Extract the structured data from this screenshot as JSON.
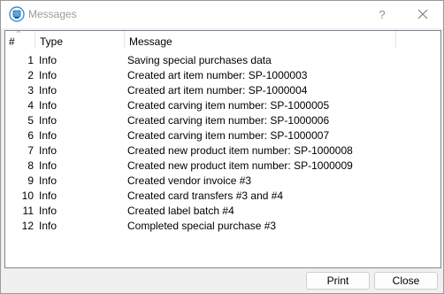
{
  "window": {
    "title": "Messages",
    "help_label": "?"
  },
  "table": {
    "columns": {
      "number": "#",
      "type": "Type",
      "message": "Message"
    },
    "rows": [
      {
        "num": "1",
        "type": "Info",
        "message": "Saving special purchases data"
      },
      {
        "num": "2",
        "type": "Info",
        "message": "Created art item number: SP-1000003"
      },
      {
        "num": "3",
        "type": "Info",
        "message": "Created art item number: SP-1000004"
      },
      {
        "num": "4",
        "type": "Info",
        "message": "Created carving item number: SP-1000005"
      },
      {
        "num": "5",
        "type": "Info",
        "message": "Created carving item number: SP-1000006"
      },
      {
        "num": "6",
        "type": "Info",
        "message": "Created carving item number: SP-1000007"
      },
      {
        "num": "7",
        "type": "Info",
        "message": "Created new product item number: SP-1000008"
      },
      {
        "num": "8",
        "type": "Info",
        "message": "Created new product item number: SP-1000009"
      },
      {
        "num": "9",
        "type": "Info",
        "message": "Created vendor invoice #3"
      },
      {
        "num": "10",
        "type": "Info",
        "message": "Created card transfers #3 and #4"
      },
      {
        "num": "11",
        "type": "Info",
        "message": "Created label batch #4"
      },
      {
        "num": "12",
        "type": "Info",
        "message": "Completed special purchase #3"
      }
    ]
  },
  "buttons": {
    "print": "Print",
    "close": "Close"
  },
  "icons": {
    "app": "app-icon",
    "sort": "sort-arrow-icon",
    "close": "close-icon"
  }
}
